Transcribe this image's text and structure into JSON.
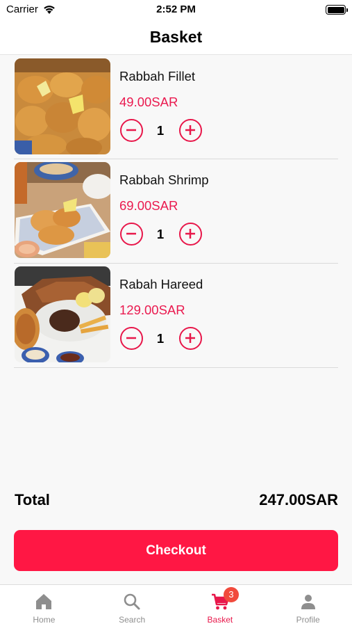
{
  "status_bar": {
    "carrier": "Carrier",
    "time": "2:52 PM"
  },
  "header": {
    "title": "Basket"
  },
  "items": [
    {
      "name": "Rabbah Fillet",
      "price": "49.00SAR",
      "quantity": "1"
    },
    {
      "name": "Rabbah Shrimp",
      "price": "69.00SAR",
      "quantity": "1"
    },
    {
      "name": "Rabah Hareed",
      "price": "129.00SAR",
      "quantity": "1"
    }
  ],
  "summary": {
    "total_label": "Total",
    "total_value": "247.00SAR",
    "checkout_label": "Checkout"
  },
  "tabbar": {
    "tabs": [
      {
        "label": "Home",
        "icon": "home-icon"
      },
      {
        "label": "Search",
        "icon": "search-icon"
      },
      {
        "label": "Basket",
        "icon": "cart-icon",
        "badge": "3"
      },
      {
        "label": "Profile",
        "icon": "person-icon"
      }
    ],
    "active": "Basket"
  },
  "colors": {
    "accent": "#ff1744",
    "price": "#ea1a4f",
    "badge": "#f14a3c"
  }
}
